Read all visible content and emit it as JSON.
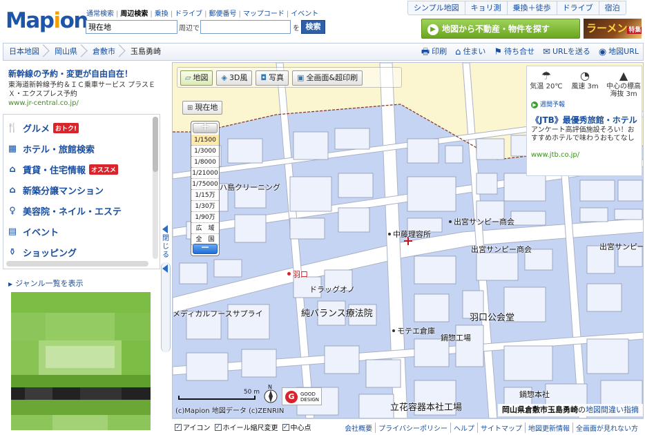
{
  "logo": {
    "text_pre": "Map",
    "text_o": "i",
    "text_post": "on"
  },
  "header": {
    "search_tabs": [
      "通常検索",
      "周辺検索",
      "乗換",
      "ドライブ",
      "郵便番号",
      "マップコード",
      "イベント"
    ],
    "active_tab": "周辺検索",
    "keyword_value": "現在地",
    "near_label": "周辺で",
    "near_value": "",
    "wo_label": "を",
    "search_button": "検索",
    "top_links": [
      "シンプル地図",
      "キョリ測",
      "乗換＋徒歩",
      "ドライブ",
      "宿泊"
    ],
    "banner_green": "地図から不動産・物件を探す",
    "banner_ramen": "ラーメン",
    "banner_ramen_sub": "特集"
  },
  "breadcrumb": {
    "items": [
      "日本地図",
      "岡山県",
      "倉敷市",
      "玉島勇崎"
    ],
    "actions": [
      {
        "icon": "printer-icon",
        "glyph": "🖶",
        "label": "印刷"
      },
      {
        "icon": "house-icon",
        "glyph": "⌂",
        "label": "住まい"
      },
      {
        "icon": "flag-icon",
        "glyph": "⚑",
        "label": "待ち合せ"
      },
      {
        "icon": "mail-icon",
        "glyph": "✉",
        "label": "URLを送る"
      },
      {
        "icon": "map-url-icon",
        "glyph": "◉",
        "label": "地図URL"
      }
    ]
  },
  "sidebar": {
    "ad": {
      "title": "新幹線の予約・変更が自由自在！",
      "desc": "東海道新幹線予約＆ＩＣ乗車サービス プラスＥＸ・エクスプレス予約",
      "url": "www.jr-central.co.jp/"
    },
    "genres": [
      {
        "icon": "cutlery-icon",
        "glyph": "🍴",
        "label": "グルメ",
        "badge": "おトク!"
      },
      {
        "icon": "hotel-icon",
        "glyph": "▦",
        "label": "ホテル・旅館検索",
        "badge": ""
      },
      {
        "icon": "house-icon",
        "glyph": "⌂",
        "label": "賃貸・住宅情報",
        "badge": "オススメ"
      },
      {
        "icon": "house-icon",
        "glyph": "⌂",
        "label": "新築分譲マンション",
        "badge": ""
      },
      {
        "icon": "beauty-icon",
        "glyph": "♀",
        "label": "美容院・ネイル・エステ",
        "badge": ""
      },
      {
        "icon": "event-icon",
        "glyph": "▤",
        "label": "イベント",
        "badge": ""
      },
      {
        "icon": "shopping-icon",
        "glyph": "⚱",
        "label": "ショッピング",
        "badge": ""
      }
    ],
    "genre_all": "ジャンル一覧を表示",
    "collapse_label": "閉じる"
  },
  "map": {
    "toolbar": [
      {
        "icon": "map-icon",
        "glyph": "▱",
        "label": "地図",
        "selected": true
      },
      {
        "icon": "3d-icon",
        "glyph": "◈",
        "label": "3D風",
        "selected": false
      },
      {
        "icon": "camera-icon",
        "glyph": "◘",
        "label": "写真",
        "selected": false
      },
      {
        "icon": "print-full-icon",
        "glyph": "▣",
        "label": "全画面&超印刷",
        "selected": false
      }
    ],
    "current_btn": "現在地",
    "zoom_plus": "＋",
    "zoom_minus": "－",
    "scales": [
      "1/1500",
      "1/3000",
      "1/8000",
      "1/21000",
      "1/75000",
      "1/15万",
      "1/30万",
      "1/90万",
      "広　域",
      "全　国"
    ],
    "selected_scale": "1/1500",
    "weather": {
      "items": [
        {
          "icon": "umbrella-icon",
          "glyph": "☂",
          "label": "気温 20℃"
        },
        {
          "icon": "wind-icon",
          "glyph": "◔",
          "label": "風速 3m"
        },
        {
          "icon": "mountain-icon",
          "glyph": "▲",
          "label": "中心の標高 海抜 3m"
        }
      ],
      "forecast": "週間予報",
      "jtb_title": "《JTB》最優秀旅館・ホテル",
      "jtb_desc": "アンケート高評価施設そろい！おすすめホテルで味わうおもてなし",
      "jtb_url": "www.jtb.co.jp/"
    },
    "labels": {
      "cleaning": "ハ島クリーニング",
      "barber": "中藤理容所",
      "demiya1": "出宮サンピー商会",
      "demiya2": "出宮サンピー商会",
      "demiya3": "出宮サンピ一商会",
      "hanekuchi": "羽口",
      "drug": "ドラッグオノ",
      "medical": "メディカルフースサプライ",
      "balance": "純バランス療法院",
      "kominkan": "羽口公会堂",
      "moteko": "モテエ倉庫",
      "nabeso": "鍋惣工場",
      "nabeso_honsha": "鍋惣本社",
      "ritsuka": "立花容器本社工場"
    },
    "scale_bar": "50 m",
    "good_design": "GOOD DESIGN",
    "copyright": "(c)Mapion 地図データ (c)ZENRIN",
    "address": "岡山県倉敷市玉島勇崎",
    "address_suffix": "の",
    "report_link": "地図間違い指摘"
  },
  "bottom": {
    "options": [
      "アイコン",
      "ホイール縮尺変更",
      "中心点"
    ],
    "links": [
      "会社概要",
      "プライバシーポリシー",
      "ヘルプ",
      "サイトマップ",
      "地図更新情報",
      "全画面が見れない方"
    ]
  },
  "colors": {
    "brand": "#1d55a8",
    "accent": "#f5a000",
    "link": "#1a4fa0",
    "map_bg": "#c6d4f4",
    "building": "#eef2fc"
  }
}
